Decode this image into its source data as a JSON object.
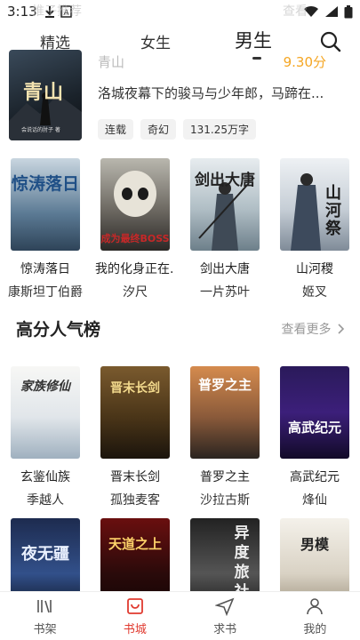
{
  "status_bar": {
    "time": "3:13",
    "ghost_left": "推子推荐",
    "ghost_right": "查看"
  },
  "top_tabs": [
    {
      "label": "精选"
    },
    {
      "label": "女生"
    },
    {
      "label": "男生",
      "active": true
    }
  ],
  "featured": {
    "cover_title": "青山",
    "cover_author": "会说话的肘子 著",
    "title": "青山",
    "score": "9.30分",
    "description": "洛城夜幕下的骏马与少年郎，马蹄在...",
    "tags": [
      "连载",
      "奇幻",
      "131.25万字"
    ]
  },
  "row1": [
    {
      "title": "惊涛落日",
      "author": "康斯坦丁伯爵",
      "cover_text": "惊涛落日"
    },
    {
      "title": "我的化身正在...",
      "author": "汐尺",
      "cover_text": "成为最终BOSS"
    },
    {
      "title": "剑出大唐",
      "author": "一片苏叶",
      "cover_text": "剑出大唐"
    },
    {
      "title": "山河稷",
      "author": "姬叉",
      "cover_text": "山河祭"
    }
  ],
  "section": {
    "title": "高分人气榜",
    "see_more": "查看更多"
  },
  "row2": [
    {
      "title": "玄鉴仙族",
      "author": "季越人",
      "cover_text": "家族修仙"
    },
    {
      "title": "晋末长剑",
      "author": "孤独麦客",
      "cover_text": "晋末长剑"
    },
    {
      "title": "普罗之主",
      "author": "沙拉古斯",
      "cover_text": "普罗之主"
    },
    {
      "title": "高武纪元",
      "author": "烽仙",
      "cover_text": "高武纪元"
    }
  ],
  "row3": [
    {
      "cover_text": "夜无疆"
    },
    {
      "cover_text": "天道之上"
    },
    {
      "cover_text": "异度旅社"
    },
    {
      "cover_text": "男模"
    }
  ],
  "bottom_nav": [
    {
      "label": "书架",
      "icon": "bookshelf-icon"
    },
    {
      "label": "书城",
      "icon": "bookstore-icon",
      "active": true
    },
    {
      "label": "求书",
      "icon": "send-icon"
    },
    {
      "label": "我的",
      "icon": "profile-icon"
    }
  ],
  "colors": {
    "accent": "#e03a2f",
    "score": "#f5a623"
  }
}
